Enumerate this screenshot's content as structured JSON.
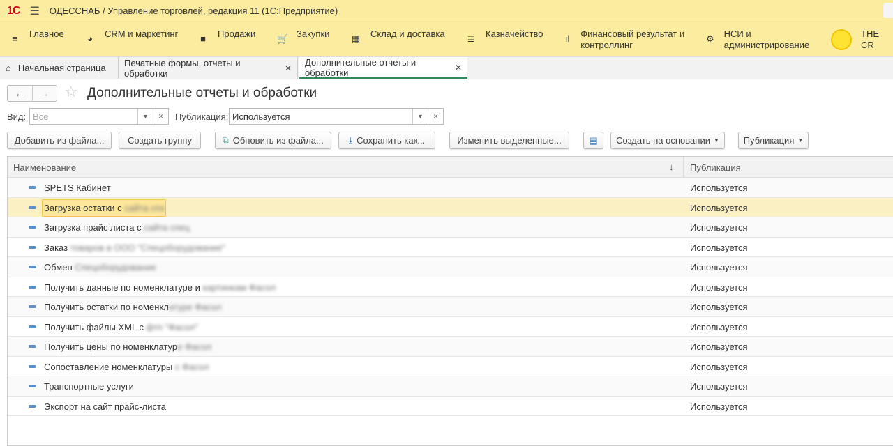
{
  "titlebar": {
    "logo": "1С",
    "title": "ОДЕССНАБ / Управление торговлей, редакция 11  (1С:Предприятие)"
  },
  "menu": [
    {
      "label": "Главное",
      "icon": "menu-icon"
    },
    {
      "label": "CRM и маркетинг",
      "icon": "pie-chart-icon"
    },
    {
      "label": "Продажи",
      "icon": "bag-icon"
    },
    {
      "label": "Закупки",
      "icon": "cart-icon"
    },
    {
      "label": "Склад и доставка",
      "icon": "warehouse-icon"
    },
    {
      "label": "Казначейство",
      "icon": "coins-icon"
    },
    {
      "label": "Финансовый результат и контроллинг",
      "icon": "bar-chart-icon"
    },
    {
      "label": "НСИ и администрирование",
      "icon": "gear-icon"
    }
  ],
  "brand_text": "THE CR",
  "tabs": [
    {
      "label": "Начальная страница"
    },
    {
      "label": "Печатные формы, отчеты и обработки"
    },
    {
      "label": "Дополнительные отчеты и обработки",
      "active": true
    }
  ],
  "page": {
    "title": "Дополнительные отчеты и обработки"
  },
  "filters": {
    "vid_label": "Вид:",
    "vid_placeholder": "Все",
    "pub_label": "Публикация:",
    "pub_value": "Используется"
  },
  "toolbar": {
    "add_from_file": "Добавить из файла...",
    "create_group": "Создать группу",
    "update_from_file": "Обновить из файла...",
    "save_as": "Сохранить как...",
    "edit_selected": "Изменить выделенные...",
    "create_based_on": "Создать на основании",
    "publication": "Публикация"
  },
  "grid": {
    "columns": [
      "Наименование",
      "Публикация"
    ],
    "rows": [
      {
        "name": "SPETS Кабинет",
        "hidden": "",
        "pub": "Используется"
      },
      {
        "name": "Загрузка остатки с ",
        "hidden": "сайта спз",
        "pub": "Используется",
        "selected": true
      },
      {
        "name": "Загрузка прайс листа с ",
        "hidden": "сайта спец",
        "pub": "Используется"
      },
      {
        "name": "Заказ ",
        "hidden": "товаров в ООО \"Спецоборудование\"",
        "pub": "Используется"
      },
      {
        "name": "Обмен ",
        "hidden": "Спецоборудование",
        "pub": "Используется"
      },
      {
        "name": "Получить данные по номенклатуре и ",
        "hidden": "картинкам Фасол",
        "pub": "Используется"
      },
      {
        "name": "Получить остатки по номенкл",
        "hidden": "атуре Фасол",
        "pub": "Используется"
      },
      {
        "name": "Получить файлы XML с ",
        "hidden": "фтп \"Фасол\"",
        "pub": "Используется"
      },
      {
        "name": "Получить цены по номенклатур",
        "hidden": "е Фасол",
        "pub": "Используется"
      },
      {
        "name": "Сопоставление номенклатуры ",
        "hidden": "с Фасол",
        "pub": "Используется"
      },
      {
        "name": "Транспортные услуги",
        "hidden": "",
        "pub": "Используется"
      },
      {
        "name": "Экспорт на сайт прайс-листа",
        "hidden": "",
        "pub": "Используется"
      }
    ]
  }
}
